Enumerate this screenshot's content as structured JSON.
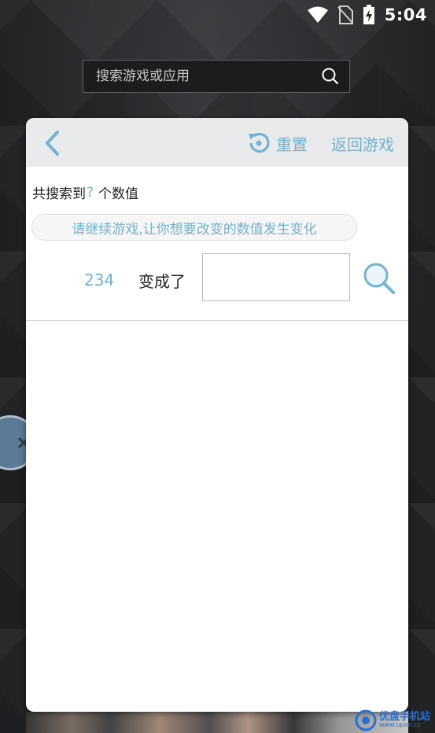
{
  "status_bar": {
    "time": "5:04"
  },
  "search": {
    "placeholder": "搜索游戏或应用"
  },
  "dialog": {
    "reset_label": "重置",
    "return_label": "返回游戏",
    "count_prefix": "共搜索到",
    "count_value": "?",
    "count_suffix": "个数值",
    "hint": "请继续游戏,让你想要改变的数值发生变化",
    "current_value": "234",
    "changed_label": "变成了",
    "new_value": ""
  },
  "watermark": {
    "text": "优盘手机站",
    "url": "www.upan.cc"
  },
  "colors": {
    "accent": "#73b2d1",
    "header_bg": "#e9eaeb"
  }
}
